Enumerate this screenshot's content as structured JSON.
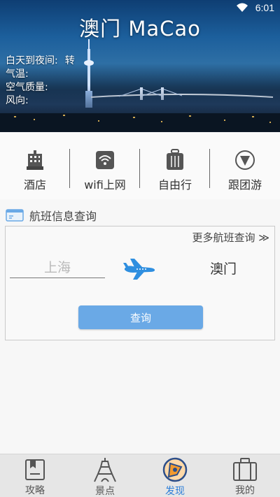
{
  "status": {
    "time": "6:01"
  },
  "header": {
    "title": "澳门  MaCao"
  },
  "weather": [
    {
      "label": "白天到夜间:",
      "value": "转"
    },
    {
      "label": "气温:",
      "value": ""
    },
    {
      "label": "空气质量:",
      "value": ""
    },
    {
      "label": "风向:",
      "value": ""
    }
  ],
  "categories": [
    {
      "label": "酒店",
      "icon": "hotel-icon"
    },
    {
      "label": "wifi上网",
      "icon": "wifi-icon"
    },
    {
      "label": "自由行",
      "icon": "luggage-icon"
    },
    {
      "label": "跟团游",
      "icon": "compass-icon"
    }
  ],
  "flight": {
    "section_title": "航班信息查询",
    "more_link": "更多航班查询 ≫",
    "from_placeholder": "上海",
    "to_city": "澳门",
    "query_button": "查询"
  },
  "tabs": [
    {
      "label": "攻略",
      "icon": "guide-icon",
      "active": false
    },
    {
      "label": "景点",
      "icon": "tower-icon",
      "active": false
    },
    {
      "label": "发现",
      "icon": "discover-icon",
      "active": true
    },
    {
      "label": "我的",
      "icon": "profile-bag-icon",
      "active": false
    }
  ],
  "colors": {
    "accent": "#2d7fd8",
    "button": "#6aa9e6"
  }
}
